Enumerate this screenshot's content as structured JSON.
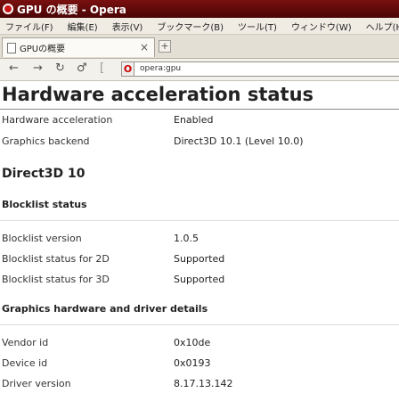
{
  "window": {
    "title": "GPU の概要 - Opera"
  },
  "menu": [
    "ファイル(F)",
    "編集(E)",
    "表示(V)",
    "ブックマーク(B)",
    "ツール(T)",
    "ウィンドウ(W)",
    "ヘルプ(H)"
  ],
  "tab": {
    "title": "GPUの概要",
    "close": "×",
    "new_tab": "+"
  },
  "nav": {
    "address": "opera:gpu"
  },
  "page": {
    "title": "Hardware acceleration status",
    "status_rows": [
      {
        "label": "Hardware acceleration",
        "value": "Enabled"
      },
      {
        "label": "Graphics backend",
        "value": "Direct3D 10.1 (Level 10.0)"
      }
    ],
    "section_d3d": "Direct3D 10",
    "section_blocklist": "Blocklist status",
    "blocklist_rows": [
      {
        "label": "Blocklist version",
        "value": "1.0.5"
      },
      {
        "label": "Blocklist status for 2D",
        "value": "Supported"
      },
      {
        "label": "Blocklist status for 3D",
        "value": "Supported"
      }
    ],
    "section_hw": "Graphics hardware and driver details",
    "hw_rows": [
      {
        "label": "Vendor id",
        "value": "0x10de"
      },
      {
        "label": "Device id",
        "value": "0x0193"
      },
      {
        "label": "Driver version",
        "value": "8.17.13.142"
      }
    ]
  }
}
